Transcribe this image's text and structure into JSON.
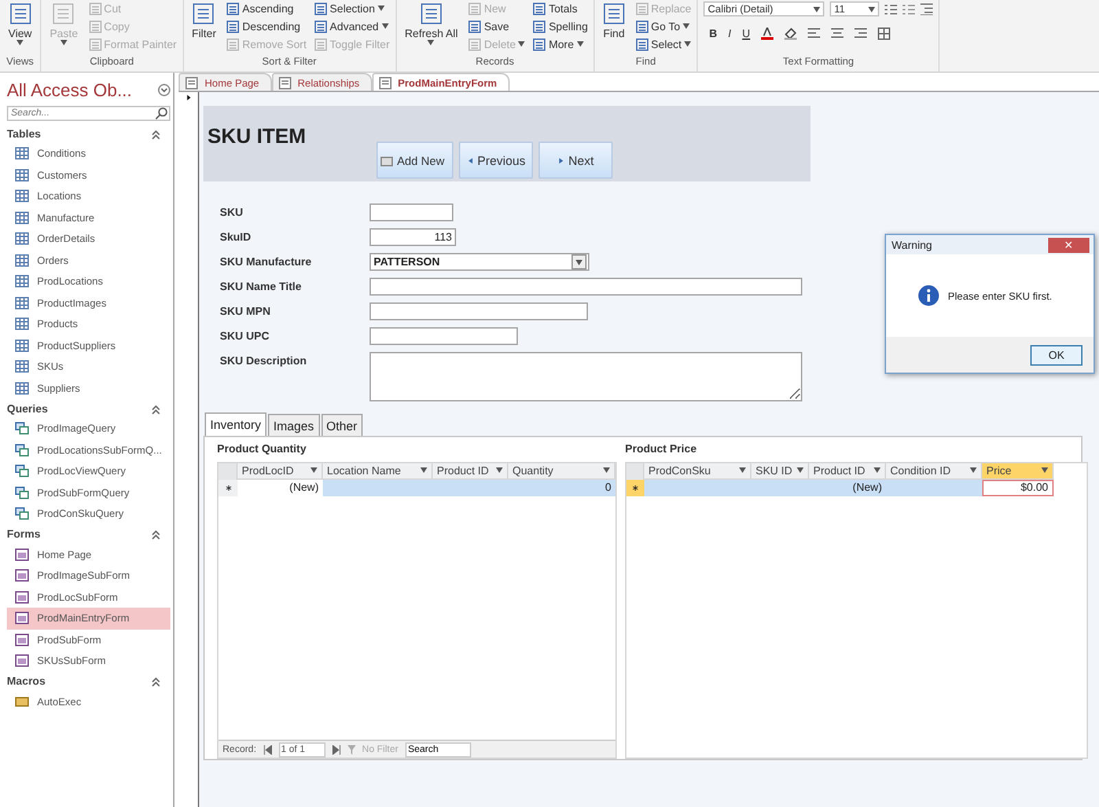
{
  "ribbon": {
    "groups": [
      {
        "label": "Views",
        "columns": [
          {
            "kind": "large",
            "label": "View",
            "disabled": false,
            "dropdown": true
          }
        ]
      },
      {
        "label": "Clipboard",
        "columns": [
          {
            "kind": "large",
            "label": "Paste",
            "disabled": true,
            "dropdown": true
          },
          {
            "kind": "stack",
            "items": [
              {
                "label": "Cut",
                "disabled": true,
                "dropdown": false
              },
              {
                "label": "Copy",
                "disabled": true,
                "dropdown": false
              },
              {
                "label": "Format Painter",
                "disabled": true,
                "dropdown": false
              }
            ]
          }
        ]
      },
      {
        "label": "Sort & Filter",
        "columns": [
          {
            "kind": "large",
            "label": "Filter",
            "disabled": false,
            "dropdown": false
          },
          {
            "kind": "stack",
            "items": [
              {
                "label": "Ascending",
                "disabled": false,
                "dropdown": false
              },
              {
                "label": "Descending",
                "disabled": false,
                "dropdown": false
              },
              {
                "label": "Remove Sort",
                "disabled": true,
                "dropdown": false
              }
            ]
          },
          {
            "kind": "stack",
            "items": [
              {
                "label": "Selection",
                "disabled": false,
                "dropdown": true
              },
              {
                "label": "Advanced",
                "disabled": false,
                "dropdown": true
              },
              {
                "label": "Toggle Filter",
                "disabled": true,
                "dropdown": false
              }
            ]
          }
        ]
      },
      {
        "label": "Records",
        "columns": [
          {
            "kind": "large",
            "label": "Refresh All",
            "disabled": false,
            "dropdown": true
          },
          {
            "kind": "stack",
            "items": [
              {
                "label": "New",
                "disabled": true,
                "dropdown": false
              },
              {
                "label": "Save",
                "disabled": false,
                "dropdown": false
              },
              {
                "label": "Delete",
                "disabled": true,
                "dropdown": true
              }
            ]
          },
          {
            "kind": "stack",
            "items": [
              {
                "label": "Totals",
                "disabled": false,
                "dropdown": false
              },
              {
                "label": "Spelling",
                "disabled": false,
                "dropdown": false
              },
              {
                "label": "More",
                "disabled": false,
                "dropdown": true
              }
            ]
          }
        ]
      },
      {
        "label": "Find",
        "columns": [
          {
            "kind": "large",
            "label": "Find",
            "disabled": false,
            "dropdown": false
          },
          {
            "kind": "stack",
            "items": [
              {
                "label": "Replace",
                "disabled": true,
                "dropdown": false
              },
              {
                "label": "Go To",
                "disabled": false,
                "dropdown": true
              },
              {
                "label": "Select",
                "disabled": false,
                "dropdown": true
              }
            ]
          }
        ]
      },
      {
        "label": "Text Formatting",
        "columns": [
          {
            "kind": "font",
            "font": "Calibri (Detail)",
            "size": "11",
            "styles": [
              "B",
              "I",
              "U"
            ]
          }
        ]
      }
    ]
  },
  "nav": {
    "title": "All Access Ob...",
    "search": {
      "placeholder": "Search..."
    },
    "sections": [
      {
        "title": "Tables",
        "kind": "table",
        "items": [
          {
            "label": "Conditions",
            "selected": false
          },
          {
            "label": "Customers",
            "selected": false
          },
          {
            "label": "Locations",
            "selected": false
          },
          {
            "label": "Manufacture",
            "selected": false
          },
          {
            "label": "OrderDetails",
            "selected": false
          },
          {
            "label": "Orders",
            "selected": false
          },
          {
            "label": "ProdLocations",
            "selected": false
          },
          {
            "label": "ProductImages",
            "selected": false
          },
          {
            "label": "Products",
            "selected": false
          },
          {
            "label": "ProductSuppliers",
            "selected": false
          },
          {
            "label": "SKUs",
            "selected": false
          },
          {
            "label": "Suppliers",
            "selected": false
          }
        ]
      },
      {
        "title": "Queries",
        "kind": "query",
        "items": [
          {
            "label": "ProdImageQuery",
            "selected": false
          },
          {
            "label": "ProdLocationsSubFormQ...",
            "selected": false
          },
          {
            "label": "ProdLocViewQuery",
            "selected": false
          },
          {
            "label": "ProdSubFormQuery",
            "selected": false
          },
          {
            "label": "ProdConSkuQuery",
            "selected": false
          }
        ]
      },
      {
        "title": "Forms",
        "kind": "form",
        "items": [
          {
            "label": "Home Page",
            "selected": false
          },
          {
            "label": "ProdImageSubForm",
            "selected": false
          },
          {
            "label": "ProdLocSubForm",
            "selected": false
          },
          {
            "label": "ProdMainEntryForm",
            "selected": true
          },
          {
            "label": "ProdSubForm",
            "selected": false
          },
          {
            "label": "SKUsSubForm",
            "selected": false
          }
        ]
      },
      {
        "title": "Macros",
        "kind": "macro",
        "items": [
          {
            "label": "AutoExec",
            "selected": false
          }
        ]
      }
    ]
  },
  "doc_tabs": [
    {
      "label": "Home Page",
      "selected": false
    },
    {
      "label": "Relationships",
      "selected": false
    },
    {
      "label": "ProdMainEntryForm",
      "selected": true
    }
  ],
  "form": {
    "title": "SKU ITEM",
    "buttons": [
      {
        "label": "Add New",
        "kind": "add"
      },
      {
        "label": "Previous",
        "kind": "prev"
      },
      {
        "label": "Next",
        "kind": "next"
      }
    ],
    "fields": [
      {
        "label": "SKU",
        "kind": "text"
      },
      {
        "label": "SkuID",
        "kind": "number",
        "value": "113"
      },
      {
        "label": "SKU Manufacture",
        "kind": "combo",
        "value": "PATTERSON"
      },
      {
        "label": "SKU Name Title",
        "kind": "text"
      },
      {
        "label": "SKU MPN",
        "kind": "text"
      },
      {
        "label": "SKU UPC",
        "kind": "text"
      },
      {
        "label": "SKU Description",
        "kind": "memo"
      }
    ],
    "tabs": [
      {
        "label": "Inventory",
        "selected": true
      },
      {
        "label": "Images",
        "selected": false
      },
      {
        "label": "Other",
        "selected": false
      }
    ],
    "subforms": [
      {
        "title": "Product Quantity",
        "columns": [
          {
            "label": "ProdLocID",
            "selected": false
          },
          {
            "label": "Location Name",
            "selected": false
          },
          {
            "label": "Product ID",
            "selected": false
          },
          {
            "label": "Quantity",
            "selected": false
          }
        ],
        "marker_active": false,
        "cells": [
          {
            "text": "(New)",
            "focused": true
          },
          {
            "text": "",
            "focused": false
          },
          {
            "text": "",
            "focused": false
          },
          {
            "text": "0",
            "focused": false
          }
        ],
        "record_bar": {
          "label": "Record:",
          "position": "1 of 1",
          "filter": "No Filter",
          "search": "Search"
        }
      },
      {
        "title": "Product Price",
        "columns": [
          {
            "label": "ProdConSku",
            "selected": false
          },
          {
            "label": "SKU ID",
            "selected": false
          },
          {
            "label": "Product ID",
            "selected": false
          },
          {
            "label": "Condition ID",
            "selected": false
          },
          {
            "label": "Price",
            "selected": true
          }
        ],
        "marker_active": true,
        "cells": [
          {
            "text": "",
            "focused": false
          },
          {
            "text": "",
            "focused": false
          },
          {
            "text": "(New)",
            "focused": false
          },
          {
            "text": "",
            "focused": false
          },
          {
            "text": "$0.00",
            "focused": true
          }
        ]
      }
    ]
  },
  "dialog": {
    "title": "Warning",
    "close": "✕",
    "message": "Please enter SKU first.",
    "button": "OK"
  }
}
